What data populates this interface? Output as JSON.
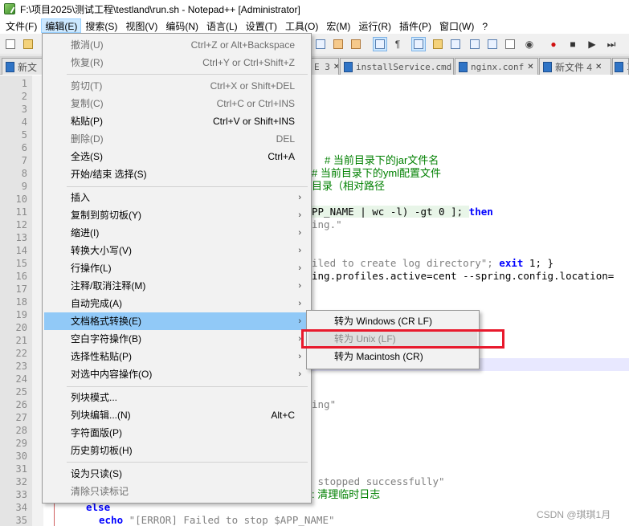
{
  "window": {
    "title": "F:\\项目2025\\测试工程\\testland\\run.sh - Notepad++ [Administrator]"
  },
  "menubar": [
    {
      "label": "文件(F)"
    },
    {
      "label": "编辑(E)"
    },
    {
      "label": "搜索(S)"
    },
    {
      "label": "视图(V)"
    },
    {
      "label": "编码(N)"
    },
    {
      "label": "语言(L)"
    },
    {
      "label": "设置(T)"
    },
    {
      "label": "工具(O)"
    },
    {
      "label": "宏(M)"
    },
    {
      "label": "运行(R)"
    },
    {
      "label": "插件(P)"
    },
    {
      "label": "窗口(W)"
    },
    {
      "label": "?"
    }
  ],
  "tabs": [
    {
      "label": "新文"
    },
    {
      "label": "E 3",
      "close": "✕"
    },
    {
      "label": "installService.cmd",
      "close": "✕"
    },
    {
      "label": "nginx.conf",
      "close": "✕"
    },
    {
      "label": "新文件 4",
      "close": "✕"
    },
    {
      "label": "I"
    }
  ],
  "editor": {
    "line_numbers": [
      "1",
      "2",
      "3",
      "4",
      "5",
      "6",
      "7",
      "8",
      "9",
      "10",
      "11",
      "12",
      "13",
      "14",
      "15",
      "16",
      "17",
      "18",
      "19",
      "20",
      "21",
      "22",
      "23",
      "24",
      "25",
      "26",
      "27",
      "28",
      "29",
      "30",
      "31",
      "32",
      "33",
      "34",
      "35"
    ],
    "snippets": {
      "l7": "# 当前目录下的jar文件名",
      "l8": "# 当前目录下的yml配置文件",
      "l9": "目录（相对路径",
      "l11_a": "PP_NAME | wc -l) -gt 0 ]; ",
      "l11_b": "then",
      "l12": "ing.\"",
      "l15_a": "iled to create log directory\"; ",
      "l15_b": "exit",
      "l15_c": " 1; }",
      "l16": "ing.profiles.active=cent --spring.config.location=",
      "l26": "ing\"",
      "l32": " stopped successfully\"",
      "l33": ": 清理临时日志",
      "l34": "else",
      "l35_a": "echo",
      "l35_b": " \"[ERROR] Failed to stop $APP_NAME\""
    }
  },
  "edit_menu": {
    "items": [
      {
        "label": "撤消(U)",
        "shortcut": "Ctrl+Z or Alt+Backspace",
        "disabled": true
      },
      {
        "label": "恢复(R)",
        "shortcut": "Ctrl+Y or Ctrl+Shift+Z",
        "disabled": true
      },
      {
        "label": "剪切(T)",
        "shortcut": "Ctrl+X or Shift+DEL",
        "disabled": true
      },
      {
        "label": "复制(C)",
        "shortcut": "Ctrl+C or Ctrl+INS",
        "disabled": true
      },
      {
        "label": "粘贴(P)",
        "shortcut": "Ctrl+V or Shift+INS",
        "disabled": false
      },
      {
        "label": "删除(D)",
        "shortcut": "DEL",
        "disabled": true
      },
      {
        "label": "全选(S)",
        "shortcut": "Ctrl+A",
        "disabled": false
      },
      {
        "label": "开始/结束 选择(S)",
        "shortcut": "",
        "disabled": false
      },
      {
        "label": "插入",
        "arrow": "›"
      },
      {
        "label": "复制到剪切板(Y)",
        "arrow": "›"
      },
      {
        "label": "缩进(I)",
        "arrow": "›"
      },
      {
        "label": "转换大小写(V)",
        "arrow": "›"
      },
      {
        "label": "行操作(L)",
        "arrow": "›"
      },
      {
        "label": "注释/取消注释(M)",
        "arrow": "›"
      },
      {
        "label": "自动完成(A)",
        "arrow": "›"
      },
      {
        "label": "文档格式转换(E)",
        "arrow": "›",
        "highlighted": true
      },
      {
        "label": "空白字符操作(B)",
        "arrow": "›"
      },
      {
        "label": "选择性粘贴(P)",
        "arrow": "›"
      },
      {
        "label": "对选中内容操作(O)",
        "arrow": "›"
      },
      {
        "label": "列块模式..."
      },
      {
        "label": "列块编辑...(N)",
        "shortcut": "Alt+C"
      },
      {
        "label": "字符面版(P)"
      },
      {
        "label": "历史剪切板(H)"
      },
      {
        "label": "设为只读(S)"
      },
      {
        "label": "清除只读标记",
        "disabled": true
      }
    ]
  },
  "eol_submenu": {
    "items": [
      {
        "label": "转为 Windows (CR LF)",
        "disabled": false
      },
      {
        "label": "转为 Unix (LF)",
        "disabled": true,
        "highlighted": true
      },
      {
        "label": "转为 Macintosh (CR)",
        "disabled": false
      }
    ]
  },
  "watermark": "CSDN @琪琪1月",
  "colors": {
    "menu_highlight": "#91c9f7",
    "annotation_box": "#e8192c",
    "comment": "#008000",
    "keyword": "#0000ff"
  }
}
